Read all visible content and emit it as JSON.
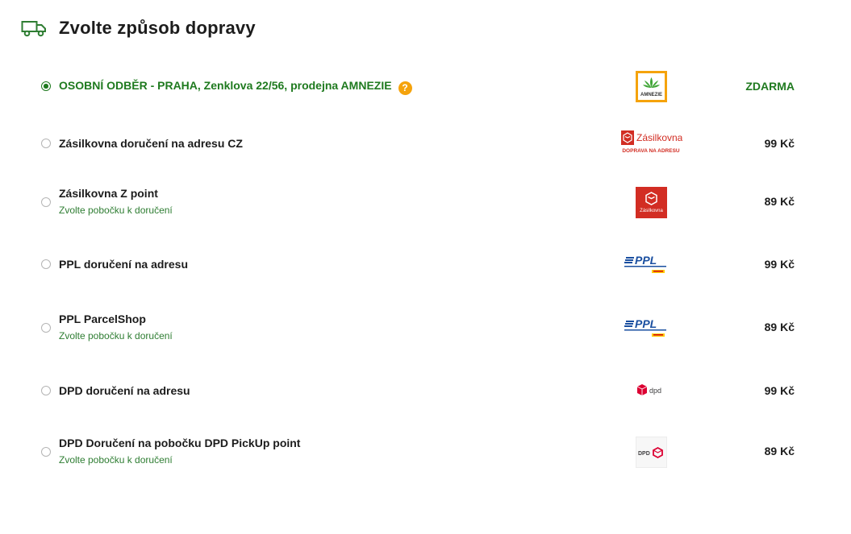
{
  "header": {
    "title": "Zvolte způsob dopravy",
    "icon": "truck-icon"
  },
  "colors": {
    "accent_green": "#1f7a1f",
    "help_orange": "#f5a30c",
    "zasilkovna_red": "#d22d23",
    "ppl_blue": "#1a4fa0",
    "dpd_red": "#dc0032"
  },
  "shipping_options": [
    {
      "name": "OSOBNÍ ODBĚR - PRAHA, Zenklova 22/56, prodejna AMNEZIE",
      "price": "ZDARMA",
      "selected": true,
      "logo": "amnezie-logo",
      "logo_text": "AMNEZIE"
    },
    {
      "name": "Zásilkovna doručení na adresu CZ",
      "price": "99 Kč",
      "selected": false,
      "logo": "zasilkovna-address-logo",
      "logo_text": "Zásilkovna",
      "logo_subtext": "DOPRAVA NA ADRESU"
    },
    {
      "name": "Zásilkovna Z point",
      "subtext": "Zvolte pobočku k doručení",
      "price": "89 Kč",
      "selected": false,
      "logo": "zasilkovna-zpoint-logo",
      "logo_text": "Zásilkovna"
    },
    {
      "name": "PPL doručení na adresu",
      "price": "99 Kč",
      "selected": false,
      "logo": "ppl-logo",
      "logo_text": "PPL"
    },
    {
      "name": "PPL ParcelShop",
      "subtext": "Zvolte pobočku k doručení",
      "price": "89 Kč",
      "selected": false,
      "logo": "ppl-logo",
      "logo_text": "PPL"
    },
    {
      "name": "DPD doručení na adresu",
      "price": "99 Kč",
      "selected": false,
      "logo": "dpd-logo",
      "logo_text": "dpd"
    },
    {
      "name": "DPD Doručení na pobočku DPD PickUp point",
      "subtext": "Zvolte pobočku k doručení",
      "price": "89 Kč",
      "selected": false,
      "logo": "dpd-pickup-logo",
      "logo_text": "DPD"
    }
  ]
}
